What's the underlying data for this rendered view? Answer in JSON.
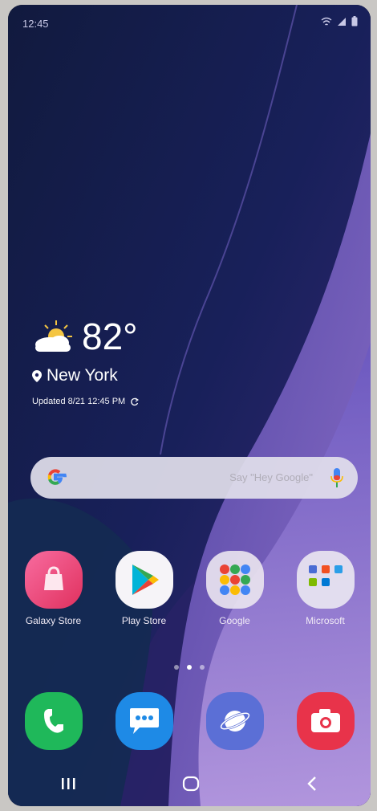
{
  "status_bar": {
    "time": "12:45"
  },
  "weather": {
    "temperature": "82°",
    "location": "New York",
    "updated": "Updated 8/21 12:45 PM"
  },
  "search": {
    "hint": "Say \"Hey Google\""
  },
  "apps": [
    {
      "label": "Galaxy Store",
      "icon": "galaxy-store-icon"
    },
    {
      "label": "Play Store",
      "icon": "play-store-icon"
    },
    {
      "label": "Google",
      "icon": "google-folder-icon"
    },
    {
      "label": "Microsoft",
      "icon": "microsoft-folder-icon"
    }
  ],
  "page_indicator": {
    "count": 3,
    "active": 2
  },
  "dock": [
    {
      "icon": "phone-icon"
    },
    {
      "icon": "messages-icon"
    },
    {
      "icon": "internet-icon"
    },
    {
      "icon": "camera-icon"
    }
  ]
}
